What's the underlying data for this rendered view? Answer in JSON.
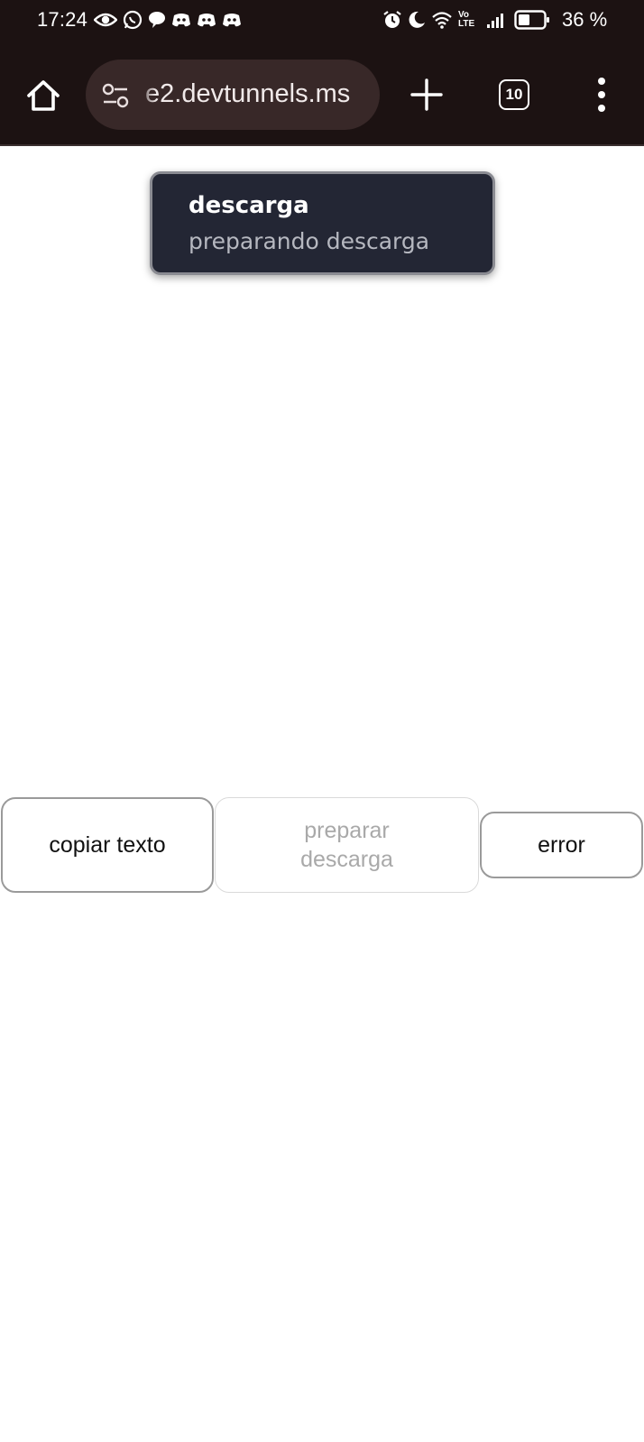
{
  "status_bar": {
    "time": "17:24",
    "battery_percent": "36 %",
    "network_label_top": "Vo",
    "network_label_bottom": "LTE"
  },
  "browser": {
    "url": "e2.devtunnels.ms",
    "tab_count": "10"
  },
  "toast": {
    "title": "descarga",
    "message": "preparando descarga"
  },
  "buttons": {
    "copy_label": "copiar texto",
    "prepare_label": "preparar descarga",
    "prepare_disabled": true,
    "error_label": "error"
  },
  "colors": {
    "browser_chrome": "#1c1212",
    "urlbar_bg": "#382828",
    "toast_bg": "#232634"
  }
}
